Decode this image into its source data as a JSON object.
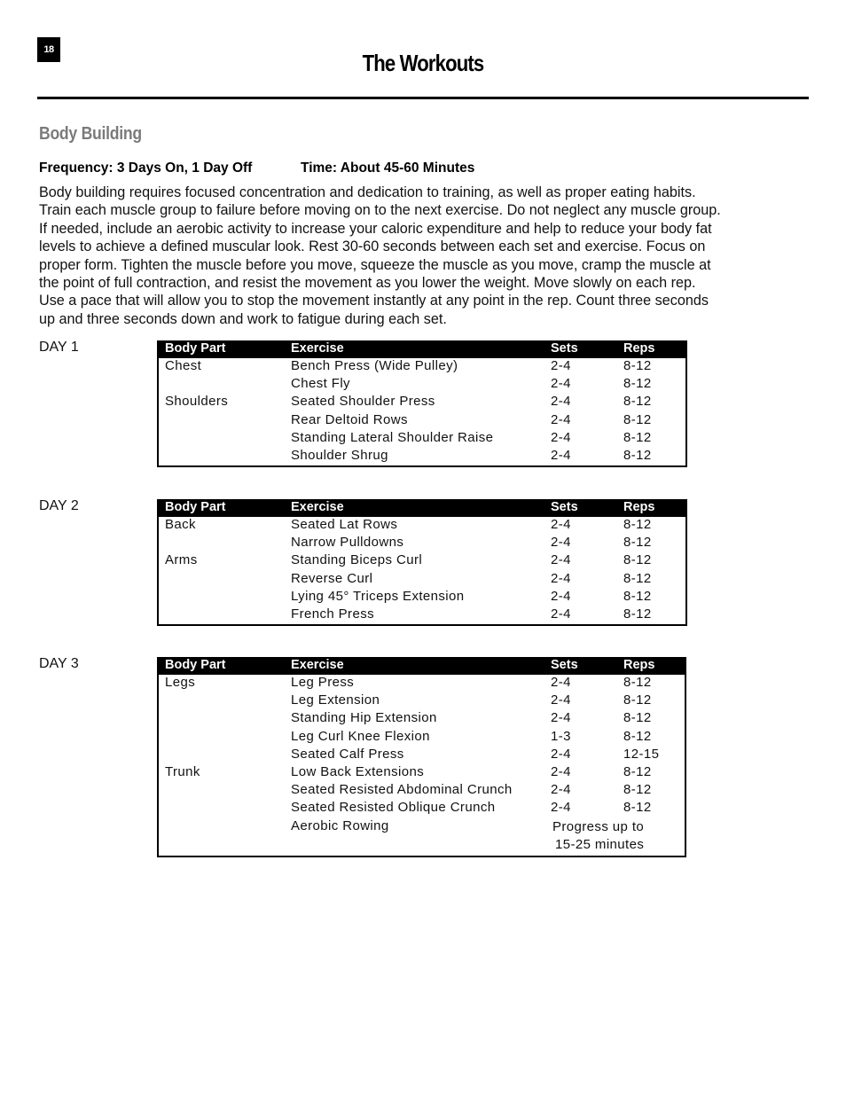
{
  "page_number": "18",
  "page_title": "The Workouts",
  "section_heading": "Body Building",
  "frequency": "Frequency: 3 Days On, 1 Day Off",
  "time": "Time: About 45-60 Minutes",
  "intro_lines": [
    "Body building requires focused concentration and dedication to training, as well as proper eating habits.",
    "Train each muscle group to failure before moving on to the next exercise. Do not neglect any muscle group.",
    "If needed, include an aerobic activity to increase your caloric expenditure and help to reduce your body fat",
    "levels to achieve a defined muscular look. Rest 30-60 seconds between each set and exercise. Focus on",
    "proper form. Tighten the muscle before you move, squeeze the muscle as you move, cramp the muscle at",
    "the point of full contraction, and resist the movement as you lower the weight. Move slowly on each rep.",
    "Use a pace that will allow you to stop the movement instantly at any point in the rep. Count three seconds",
    "up and three seconds down and work to fatigue during each set."
  ],
  "table_headers": {
    "body_part": "Body Part",
    "exercise": "Exercise",
    "sets": "Sets",
    "reps": "Reps"
  },
  "days": [
    {
      "label": "DAY 1",
      "rows": [
        {
          "body_part": "Chest",
          "exercise": "Bench Press (Wide Pulley)",
          "sets": "2-4",
          "reps": "8-12"
        },
        {
          "body_part": "",
          "exercise": "Chest Fly",
          "sets": "2-4",
          "reps": "8-12"
        },
        {
          "body_part": "Shoulders",
          "exercise": "Seated Shoulder Press",
          "sets": "2-4",
          "reps": "8-12"
        },
        {
          "body_part": "",
          "exercise": "Rear Deltoid Rows",
          "sets": "2-4",
          "reps": "8-12"
        },
        {
          "body_part": "",
          "exercise": "Standing Lateral Shoulder Raise",
          "sets": "2-4",
          "reps": "8-12"
        },
        {
          "body_part": "",
          "exercise": "Shoulder Shrug",
          "sets": "2-4",
          "reps": "8-12"
        }
      ]
    },
    {
      "label": "DAY 2",
      "rows": [
        {
          "body_part": "Back",
          "exercise": "Seated Lat Rows",
          "sets": "2-4",
          "reps": "8-12"
        },
        {
          "body_part": "",
          "exercise": "Narrow Pulldowns",
          "sets": "2-4",
          "reps": "8-12"
        },
        {
          "body_part": "Arms",
          "exercise": "Standing Biceps Curl",
          "sets": "2-4",
          "reps": "8-12"
        },
        {
          "body_part": "",
          "exercise": "Reverse Curl",
          "sets": "2-4",
          "reps": "8-12"
        },
        {
          "body_part": "",
          "exercise": "Lying 45° Triceps Extension",
          "sets": "2-4",
          "reps": "8-12"
        },
        {
          "body_part": "",
          "exercise": "French Press",
          "sets": "2-4",
          "reps": "8-12"
        }
      ]
    },
    {
      "label": "DAY 3",
      "rows": [
        {
          "body_part": "Legs",
          "exercise": "Leg Press",
          "sets": "2-4",
          "reps": "8-12"
        },
        {
          "body_part": "",
          "exercise": "Leg Extension",
          "sets": "2-4",
          "reps": "8-12"
        },
        {
          "body_part": "",
          "exercise": "Standing Hip Extension",
          "sets": "2-4",
          "reps": "8-12"
        },
        {
          "body_part": "",
          "exercise": "Leg Curl Knee Flexion",
          "sets": "1-3",
          "reps": "8-12"
        },
        {
          "body_part": "",
          "exercise": "Seated Calf Press",
          "sets": "2-4",
          "reps": "12-15"
        },
        {
          "body_part": "Trunk",
          "exercise": "Low Back Extensions",
          "sets": "2-4",
          "reps": "8-12"
        },
        {
          "body_part": "",
          "exercise": "Seated Resisted Abdominal Crunch",
          "sets": "2-4",
          "reps": "8-12"
        },
        {
          "body_part": "",
          "exercise": "Seated Resisted Oblique Crunch",
          "sets": "2-4",
          "reps": "8-12"
        },
        {
          "body_part": "",
          "exercise": "Aerobic Rowing",
          "note_line1": "Progress up to",
          "note_line2": "15-25 minutes"
        }
      ]
    }
  ]
}
